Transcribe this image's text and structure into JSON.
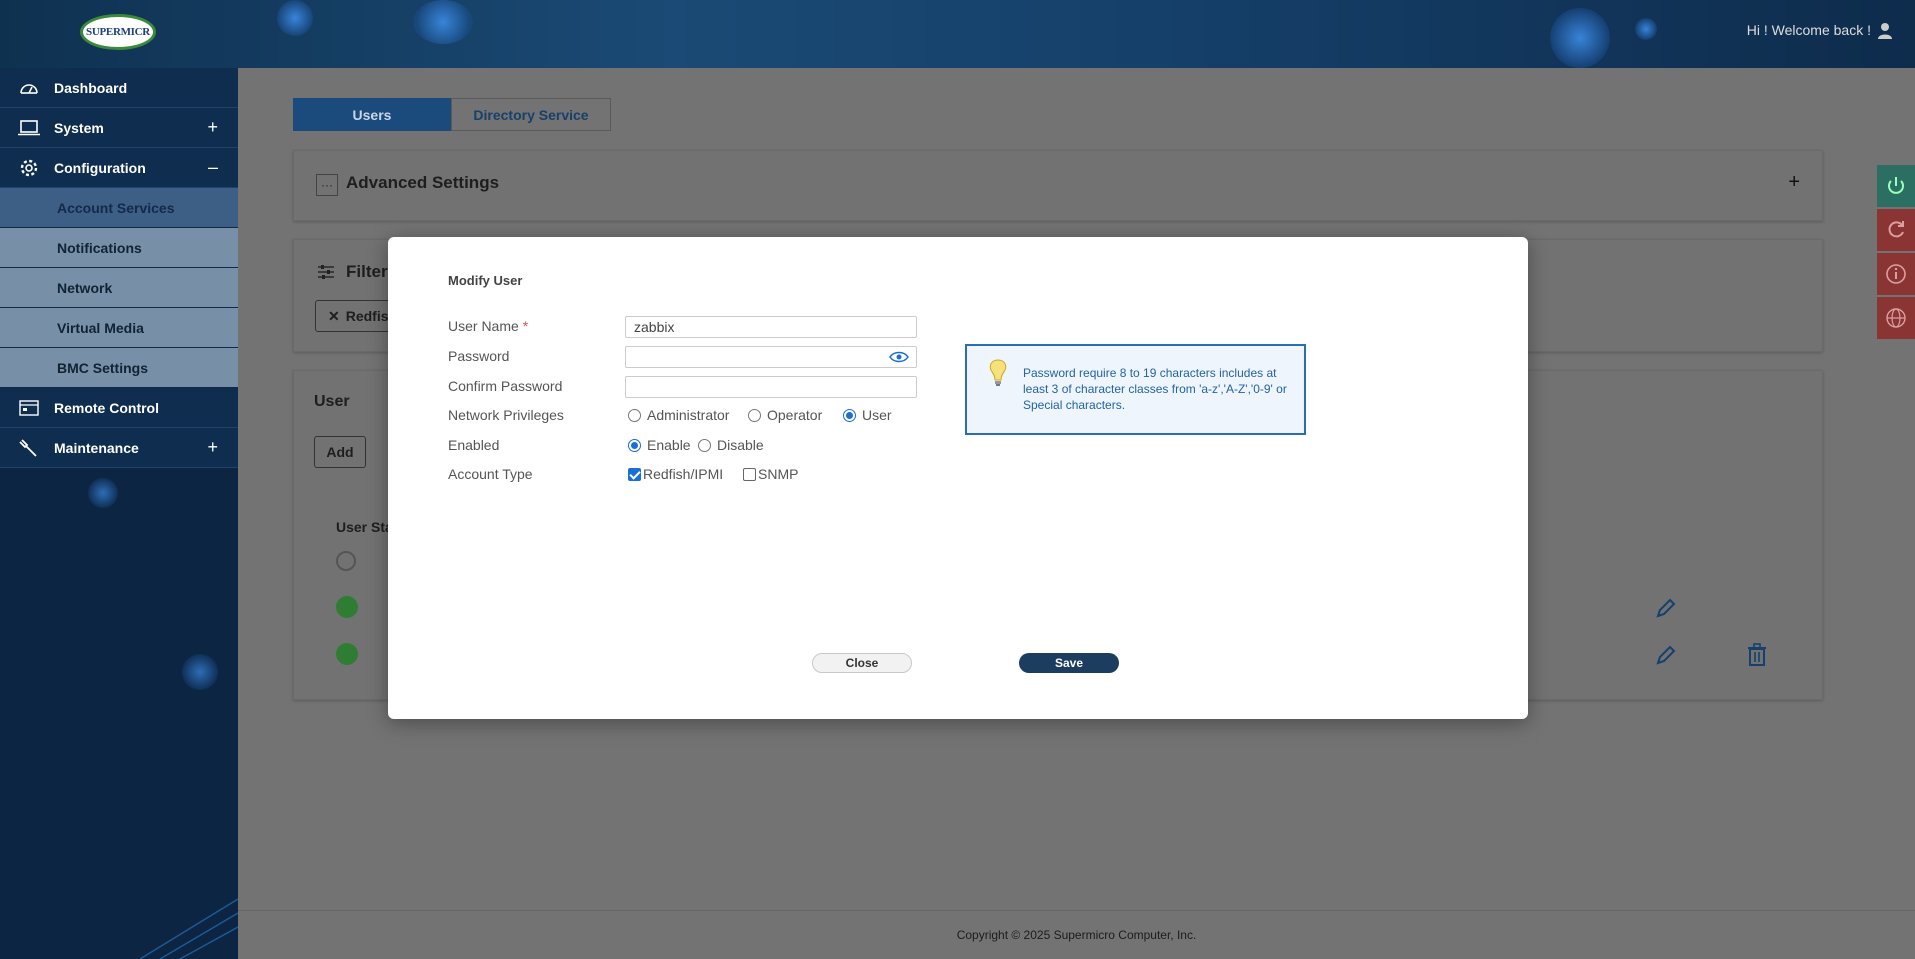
{
  "header": {
    "logo_text": "SUPERMICR",
    "welcome": "Hi ! Welcome back !"
  },
  "sidebar": {
    "items": [
      {
        "label": "Dashboard",
        "icon": "dashboard-icon"
      },
      {
        "label": "System",
        "icon": "laptop-icon",
        "sign": "+"
      },
      {
        "label": "Configuration",
        "icon": "gear-icon",
        "sign": "–"
      },
      {
        "label": "Remote Control",
        "icon": "monitor-icon"
      },
      {
        "label": "Maintenance",
        "icon": "wrench-icon",
        "sign": "+"
      }
    ],
    "sub_items": [
      "Account Services",
      "Notifications",
      "Network",
      "Virtual Media",
      "BMC Settings"
    ]
  },
  "main": {
    "tabs": [
      "Users",
      "Directory Service"
    ],
    "advanced_settings": "Advanced Settings",
    "advanced_sign": "+",
    "filter_title": "Filter",
    "filter_chip": "Redfis",
    "user_card_title": "User",
    "add_button": "Add",
    "user_status_header": "User Sta"
  },
  "modal": {
    "title": "Modify User",
    "username_label": "User Name",
    "required_mark": "*",
    "username_value": "zabbix",
    "password_label": "Password",
    "confirm_label": "Confirm Password",
    "privileges_label": "Network Privileges",
    "privileges_options": [
      "Administrator",
      "Operator",
      "User"
    ],
    "privileges_selected": "User",
    "enabled_label": "Enabled",
    "enabled_options": [
      "Enable",
      "Disable"
    ],
    "enabled_selected": "Enable",
    "account_type_label": "Account Type",
    "account_types": [
      {
        "label": "Redfish/IPMI",
        "checked": true
      },
      {
        "label": "SNMP",
        "checked": false
      }
    ],
    "tip": "Password require 8 to 19 characters includes at least 3 of character classes from 'a-z','A-Z','0-9' or Special characters.",
    "close_label": "Close",
    "save_label": "Save"
  },
  "footer": {
    "copyright": "Copyright © 2025 Supermicro Computer, Inc."
  },
  "colors": {
    "primary": "#1b4b7d",
    "header": "#15406a",
    "sidebar": "#0c2542",
    "save_button": "#1d3d60",
    "tip_border": "#2a6cb5"
  }
}
